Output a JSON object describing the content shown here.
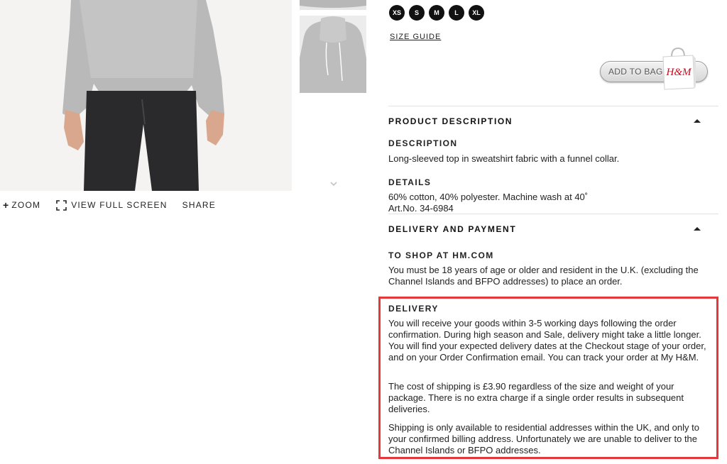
{
  "sizes": [
    "XS",
    "S",
    "M",
    "L",
    "XL"
  ],
  "size_guide": "SIZE GUIDE",
  "add_to_bag": "ADD TO BAG",
  "brand_logo": "H&M",
  "image_actions": {
    "zoom": "ZOOM",
    "full_screen": "VIEW FULL SCREEN",
    "share": "SHARE"
  },
  "product_description": {
    "heading": "PRODUCT DESCRIPTION",
    "description_label": "DESCRIPTION",
    "description_text": "Long-sleeved top in sweatshirt fabric with a funnel collar.",
    "details_label": "DETAILS",
    "details_text": "60% cotton, 40% polyester. Machine wash at 40˚",
    "art_no": "Art.No. 34-6984"
  },
  "delivery_payment": {
    "heading": "DELIVERY AND PAYMENT",
    "shop_label": "TO SHOP AT HM.COM",
    "shop_text": "You must be 18 years of age or older and resident in the U.K. (excluding the Channel Islands and BFPO addresses) to place an order.",
    "delivery_label": "DELIVERY",
    "delivery_p1": "You will receive your goods within 3-5 working days following the order confirmation. During high season and Sale, delivery might take a little longer. You will find your expected delivery dates at the Checkout stage of your order, and on your Order Confirmation email. You can track your order at My H&M.",
    "delivery_p2": "The cost of shipping is £3.90 regardless of the size and weight of your package. There is no extra charge if a single order results in subsequent deliveries.",
    "delivery_p3": "Shipping is only available to residential addresses within the UK, and only to your confirmed billing address. Unfortunately we are unable to deliver to the Channel Islands or BFPO addresses."
  },
  "colors": {
    "highlight": "#e5383b",
    "size_chip": "#111111",
    "brand_red": "#cc071e"
  }
}
